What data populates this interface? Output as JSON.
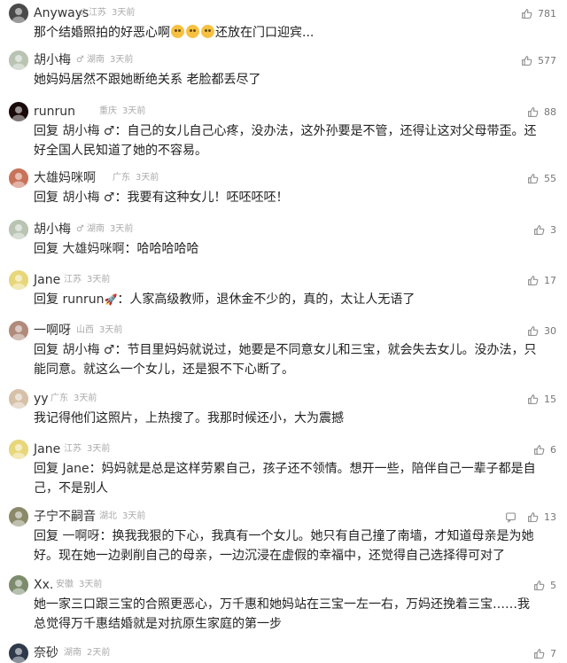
{
  "comments": [
    {
      "name": "Anyways",
      "gender": "♂",
      "location": "江苏",
      "time": "3天前",
      "likes": "781",
      "avatar_color": "#4a4a4a",
      "avatar_icon": "cartoon-avatar",
      "text": "那个结婚照拍的好恶心啊",
      "text_suffix": "还放在门口迎宾..."
    },
    {
      "name": "胡小梅",
      "gender": "♂",
      "location": "湖南",
      "time": "3天前",
      "likes": "577",
      "avatar_color": "#b9c4b2",
      "text": "她妈妈居然不跟她断绝关系 老脸都丢尽了"
    },
    {
      "name": "runrun",
      "gender": "",
      "location": "重庆",
      "time": "3天前",
      "likes": "88",
      "avatar_color": "#1a0a0a",
      "reply_prefix": "回复",
      "reply_to": "胡小梅 ♂",
      "text": "自己的女儿自己心疼，没办法，这外孙要是不管，还得让这对父母带歪。还好全国人民知道了她的不容易。"
    },
    {
      "name": "大雄妈咪啊",
      "gender": "",
      "location": "广东",
      "time": "3天前",
      "likes": "55",
      "avatar_color": "#c9735b",
      "reply_prefix": "回复",
      "reply_to": "胡小梅 ♂",
      "text": "我要有这种女儿！呸呸呸呸！"
    },
    {
      "name": "胡小梅",
      "gender": "♂",
      "location": "湖南",
      "time": "3天前",
      "likes": "3",
      "avatar_color": "#b9c4b2",
      "reply_prefix": "回复",
      "reply_to": "大雄妈咪啊",
      "text": "哈哈哈哈哈"
    },
    {
      "name": "Jane",
      "gender": "",
      "location": "江苏",
      "time": "3天前",
      "likes": "17",
      "avatar_color": "#e8d77a",
      "reply_prefix": "回复",
      "reply_to": "runrun",
      "text": "人家高级教师，退休金不少的，真的，太让人无语了"
    },
    {
      "name": "一啊呀",
      "gender": "",
      "location": "山西",
      "time": "3天前",
      "likes": "30",
      "avatar_color": "#b08a7a",
      "reply_prefix": "回复",
      "reply_to": "胡小梅 ♂",
      "text": "节目里妈妈就说过，她要是不同意女儿和三宝，就会失去女儿。没办法，只能同意。就这么一个女儿，还是狠不下心断了。"
    },
    {
      "name": "yy",
      "gender": "",
      "location": "广东",
      "time": "3天前",
      "likes": "15",
      "avatar_color": "#d6c1a8",
      "text": "我记得他们这照片，上热搜了。我那时候还小，大为震撼"
    },
    {
      "name": "Jane",
      "gender": "",
      "location": "江苏",
      "time": "3天前",
      "likes": "6",
      "avatar_color": "#e8d77a",
      "reply_prefix": "回复",
      "reply_to": "Jane",
      "text": "妈妈就是总是这样劳累自己，孩子还不领情。想开一些，陪伴自己一辈子都是自己，不是别人"
    },
    {
      "name": "子宁不嗣音",
      "gender": "",
      "location": "湖北",
      "time": "3天前",
      "likes": "13",
      "avatar_color": "#8a8a6a",
      "show_reply_icon": true,
      "reply_prefix": "回复",
      "reply_to": "一啊呀",
      "text": "换我我狠的下心，我真有一个女儿。她只有自己撞了南墙，才知道母亲是为她好。现在她一边剥削自己的母亲，一边沉浸在虚假的幸福中，还觉得自己选择得可对了"
    },
    {
      "name": "Xx.",
      "gender": "",
      "location": "安徽",
      "time": "3天前",
      "likes": "5",
      "avatar_color": "#7c8c6c",
      "text": "她一家三口跟三宝的合照更恶心，万千惠和她妈站在三宝一左一右，万妈还挽着三宝……我总觉得万千惠结婚就是对抗原生家庭的第一步"
    },
    {
      "name": "奈砂",
      "gender": "",
      "location": "湖南",
      "time": "2天前",
      "likes": "7",
      "avatar_color": "#2e3a4a",
      "text": ""
    }
  ],
  "colors": {
    "meta": "#aaaaaa",
    "name": "#333333",
    "text": "#222222",
    "background": "#ffffff"
  }
}
